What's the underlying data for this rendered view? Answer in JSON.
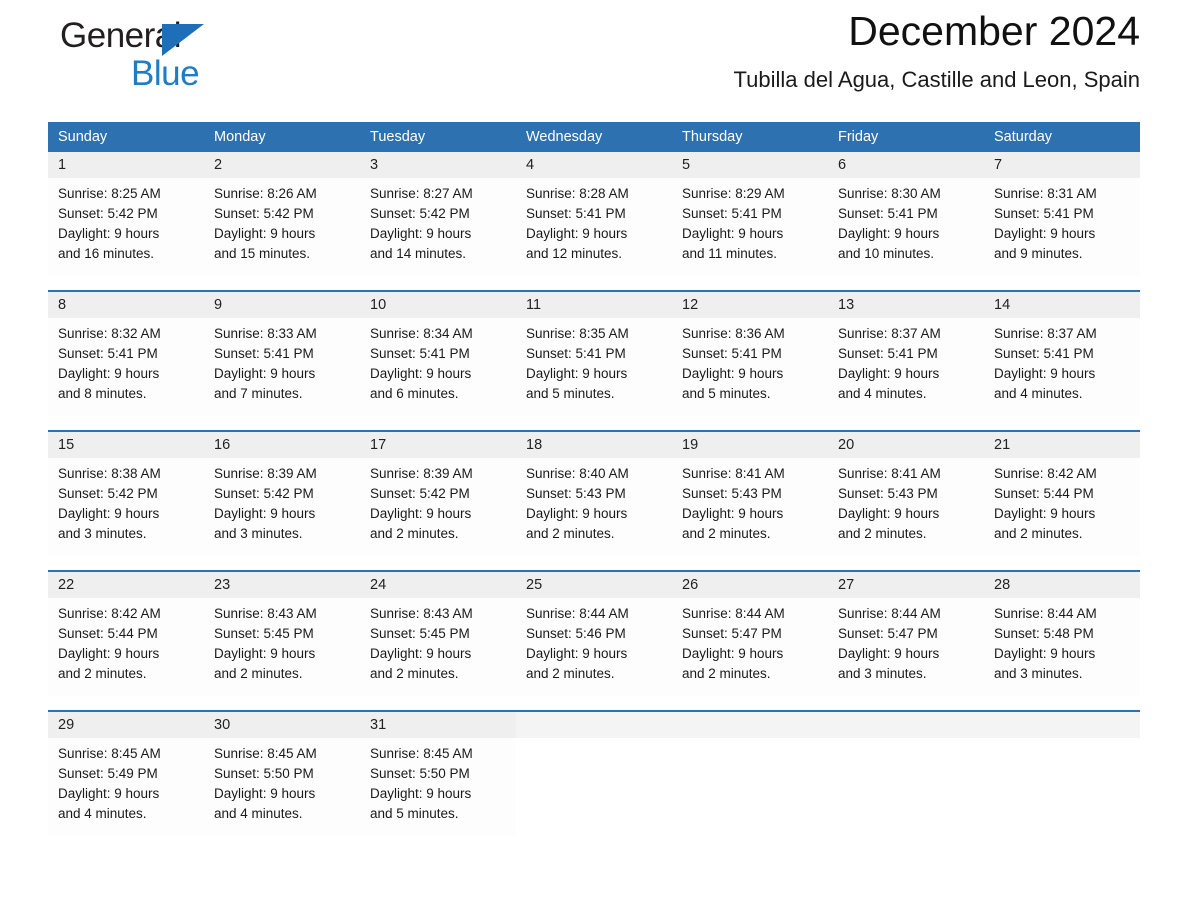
{
  "brand": {
    "name_part1": "General",
    "name_part2": "Blue",
    "triangle_icon": "triangle-icon",
    "colors": {
      "black": "#231f20",
      "blue": "#1f7dc4",
      "header_blue": "#2d71b1"
    }
  },
  "header": {
    "title": "December 2024",
    "subtitle": "Tubilla del Agua, Castille and Leon, Spain"
  },
  "calendar": {
    "weekday_headers": [
      "Sunday",
      "Monday",
      "Tuesday",
      "Wednesday",
      "Thursday",
      "Friday",
      "Saturday"
    ],
    "labels": {
      "sunrise": "Sunrise:",
      "sunset": "Sunset:",
      "daylight": "Daylight:"
    },
    "weeks": [
      {
        "days": [
          {
            "date": "1",
            "sunrise": "Sunrise: 8:25 AM",
            "sunset": "Sunset: 5:42 PM",
            "daylight_line1": "Daylight: 9 hours",
            "daylight_line2": "and 16 minutes."
          },
          {
            "date": "2",
            "sunrise": "Sunrise: 8:26 AM",
            "sunset": "Sunset: 5:42 PM",
            "daylight_line1": "Daylight: 9 hours",
            "daylight_line2": "and 15 minutes."
          },
          {
            "date": "3",
            "sunrise": "Sunrise: 8:27 AM",
            "sunset": "Sunset: 5:42 PM",
            "daylight_line1": "Daylight: 9 hours",
            "daylight_line2": "and 14 minutes."
          },
          {
            "date": "4",
            "sunrise": "Sunrise: 8:28 AM",
            "sunset": "Sunset: 5:41 PM",
            "daylight_line1": "Daylight: 9 hours",
            "daylight_line2": "and 12 minutes."
          },
          {
            "date": "5",
            "sunrise": "Sunrise: 8:29 AM",
            "sunset": "Sunset: 5:41 PM",
            "daylight_line1": "Daylight: 9 hours",
            "daylight_line2": "and 11 minutes."
          },
          {
            "date": "6",
            "sunrise": "Sunrise: 8:30 AM",
            "sunset": "Sunset: 5:41 PM",
            "daylight_line1": "Daylight: 9 hours",
            "daylight_line2": "and 10 minutes."
          },
          {
            "date": "7",
            "sunrise": "Sunrise: 8:31 AM",
            "sunset": "Sunset: 5:41 PM",
            "daylight_line1": "Daylight: 9 hours",
            "daylight_line2": "and 9 minutes."
          }
        ]
      },
      {
        "days": [
          {
            "date": "8",
            "sunrise": "Sunrise: 8:32 AM",
            "sunset": "Sunset: 5:41 PM",
            "daylight_line1": "Daylight: 9 hours",
            "daylight_line2": "and 8 minutes."
          },
          {
            "date": "9",
            "sunrise": "Sunrise: 8:33 AM",
            "sunset": "Sunset: 5:41 PM",
            "daylight_line1": "Daylight: 9 hours",
            "daylight_line2": "and 7 minutes."
          },
          {
            "date": "10",
            "sunrise": "Sunrise: 8:34 AM",
            "sunset": "Sunset: 5:41 PM",
            "daylight_line1": "Daylight: 9 hours",
            "daylight_line2": "and 6 minutes."
          },
          {
            "date": "11",
            "sunrise": "Sunrise: 8:35 AM",
            "sunset": "Sunset: 5:41 PM",
            "daylight_line1": "Daylight: 9 hours",
            "daylight_line2": "and 5 minutes."
          },
          {
            "date": "12",
            "sunrise": "Sunrise: 8:36 AM",
            "sunset": "Sunset: 5:41 PM",
            "daylight_line1": "Daylight: 9 hours",
            "daylight_line2": "and 5 minutes."
          },
          {
            "date": "13",
            "sunrise": "Sunrise: 8:37 AM",
            "sunset": "Sunset: 5:41 PM",
            "daylight_line1": "Daylight: 9 hours",
            "daylight_line2": "and 4 minutes."
          },
          {
            "date": "14",
            "sunrise": "Sunrise: 8:37 AM",
            "sunset": "Sunset: 5:41 PM",
            "daylight_line1": "Daylight: 9 hours",
            "daylight_line2": "and 4 minutes."
          }
        ]
      },
      {
        "days": [
          {
            "date": "15",
            "sunrise": "Sunrise: 8:38 AM",
            "sunset": "Sunset: 5:42 PM",
            "daylight_line1": "Daylight: 9 hours",
            "daylight_line2": "and 3 minutes."
          },
          {
            "date": "16",
            "sunrise": "Sunrise: 8:39 AM",
            "sunset": "Sunset: 5:42 PM",
            "daylight_line1": "Daylight: 9 hours",
            "daylight_line2": "and 3 minutes."
          },
          {
            "date": "17",
            "sunrise": "Sunrise: 8:39 AM",
            "sunset": "Sunset: 5:42 PM",
            "daylight_line1": "Daylight: 9 hours",
            "daylight_line2": "and 2 minutes."
          },
          {
            "date": "18",
            "sunrise": "Sunrise: 8:40 AM",
            "sunset": "Sunset: 5:43 PM",
            "daylight_line1": "Daylight: 9 hours",
            "daylight_line2": "and 2 minutes."
          },
          {
            "date": "19",
            "sunrise": "Sunrise: 8:41 AM",
            "sunset": "Sunset: 5:43 PM",
            "daylight_line1": "Daylight: 9 hours",
            "daylight_line2": "and 2 minutes."
          },
          {
            "date": "20",
            "sunrise": "Sunrise: 8:41 AM",
            "sunset": "Sunset: 5:43 PM",
            "daylight_line1": "Daylight: 9 hours",
            "daylight_line2": "and 2 minutes."
          },
          {
            "date": "21",
            "sunrise": "Sunrise: 8:42 AM",
            "sunset": "Sunset: 5:44 PM",
            "daylight_line1": "Daylight: 9 hours",
            "daylight_line2": "and 2 minutes."
          }
        ]
      },
      {
        "days": [
          {
            "date": "22",
            "sunrise": "Sunrise: 8:42 AM",
            "sunset": "Sunset: 5:44 PM",
            "daylight_line1": "Daylight: 9 hours",
            "daylight_line2": "and 2 minutes."
          },
          {
            "date": "23",
            "sunrise": "Sunrise: 8:43 AM",
            "sunset": "Sunset: 5:45 PM",
            "daylight_line1": "Daylight: 9 hours",
            "daylight_line2": "and 2 minutes."
          },
          {
            "date": "24",
            "sunrise": "Sunrise: 8:43 AM",
            "sunset": "Sunset: 5:45 PM",
            "daylight_line1": "Daylight: 9 hours",
            "daylight_line2": "and 2 minutes."
          },
          {
            "date": "25",
            "sunrise": "Sunrise: 8:44 AM",
            "sunset": "Sunset: 5:46 PM",
            "daylight_line1": "Daylight: 9 hours",
            "daylight_line2": "and 2 minutes."
          },
          {
            "date": "26",
            "sunrise": "Sunrise: 8:44 AM",
            "sunset": "Sunset: 5:47 PM",
            "daylight_line1": "Daylight: 9 hours",
            "daylight_line2": "and 2 minutes."
          },
          {
            "date": "27",
            "sunrise": "Sunrise: 8:44 AM",
            "sunset": "Sunset: 5:47 PM",
            "daylight_line1": "Daylight: 9 hours",
            "daylight_line2": "and 3 minutes."
          },
          {
            "date": "28",
            "sunrise": "Sunrise: 8:44 AM",
            "sunset": "Sunset: 5:48 PM",
            "daylight_line1": "Daylight: 9 hours",
            "daylight_line2": "and 3 minutes."
          }
        ]
      },
      {
        "days": [
          {
            "date": "29",
            "sunrise": "Sunrise: 8:45 AM",
            "sunset": "Sunset: 5:49 PM",
            "daylight_line1": "Daylight: 9 hours",
            "daylight_line2": "and 4 minutes."
          },
          {
            "date": "30",
            "sunrise": "Sunrise: 8:45 AM",
            "sunset": "Sunset: 5:50 PM",
            "daylight_line1": "Daylight: 9 hours",
            "daylight_line2": "and 4 minutes."
          },
          {
            "date": "31",
            "sunrise": "Sunrise: 8:45 AM",
            "sunset": "Sunset: 5:50 PM",
            "daylight_line1": "Daylight: 9 hours",
            "daylight_line2": "and 5 minutes."
          },
          {
            "date": "",
            "sunrise": "",
            "sunset": "",
            "daylight_line1": "",
            "daylight_line2": ""
          },
          {
            "date": "",
            "sunrise": "",
            "sunset": "",
            "daylight_line1": "",
            "daylight_line2": ""
          },
          {
            "date": "",
            "sunrise": "",
            "sunset": "",
            "daylight_line1": "",
            "daylight_line2": ""
          },
          {
            "date": "",
            "sunrise": "",
            "sunset": "",
            "daylight_line1": "",
            "daylight_line2": ""
          }
        ]
      }
    ]
  }
}
